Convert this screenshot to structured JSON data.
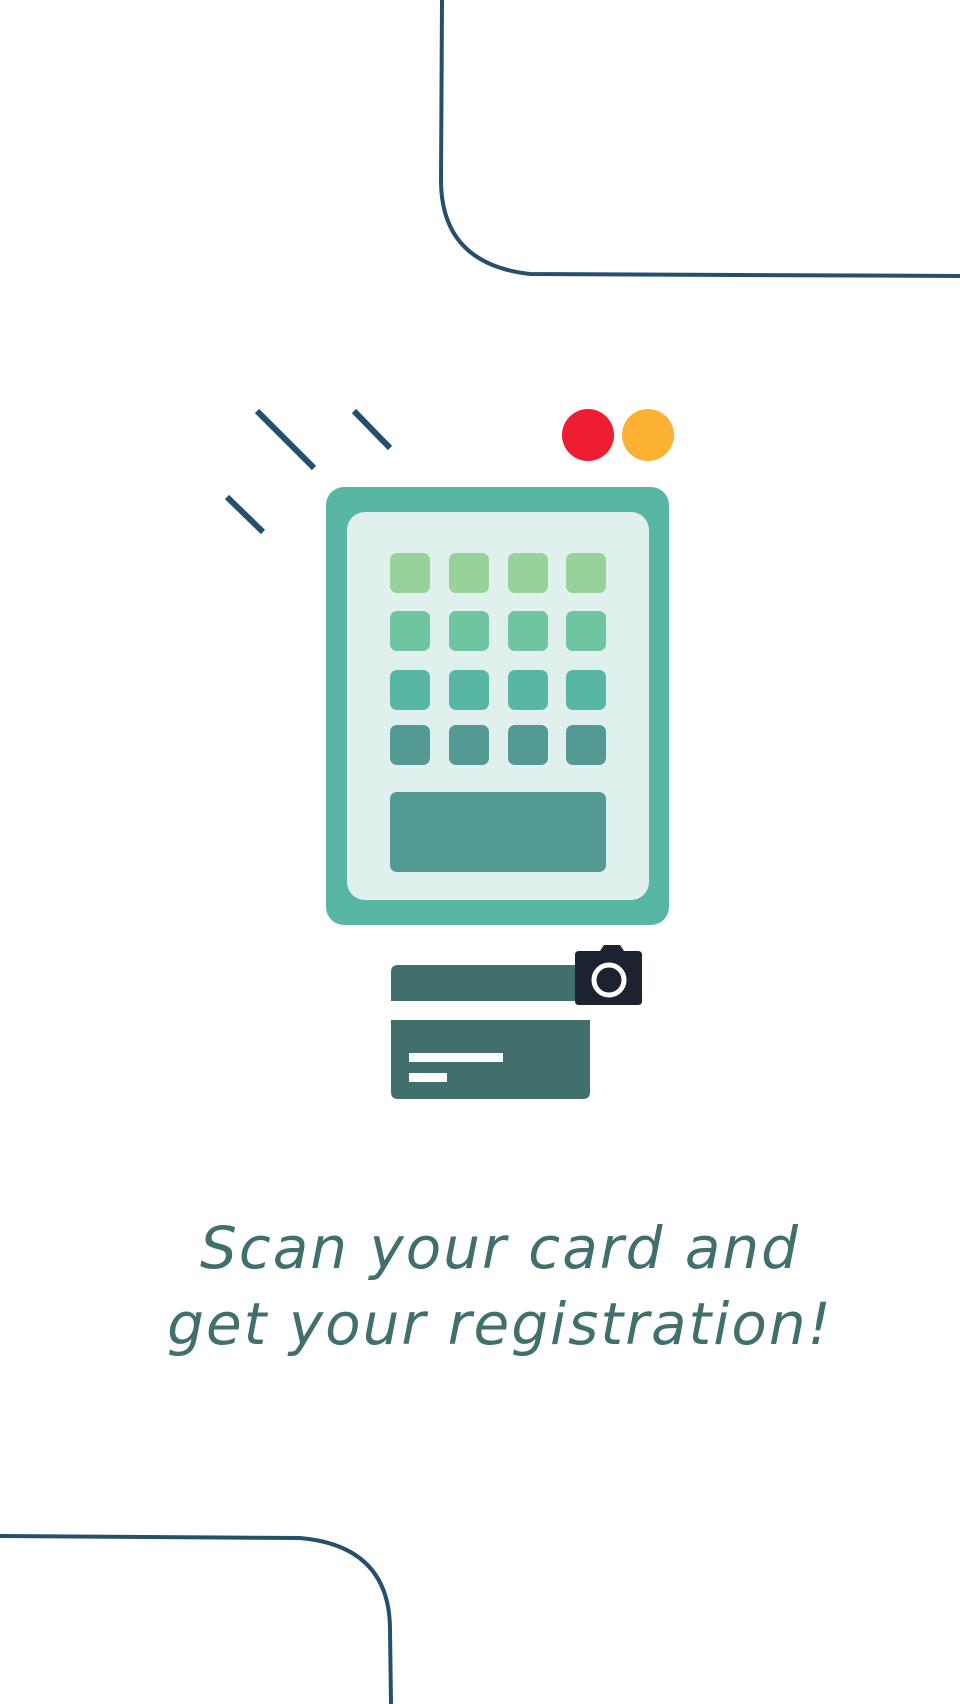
{
  "screen": {
    "name": "card-scan-onboarding"
  },
  "message": {
    "line1": "Scan your card and",
    "line2": "get your registration!"
  },
  "illustration": {
    "terminal_icon": "card-terminal-icon",
    "camera_icon": "camera-icon",
    "card_icon": "id-card-icon"
  },
  "colors": {
    "background": "#ffffff",
    "line_navy": "#264f6e",
    "terminal_frame": "#58b7a4",
    "terminal_screen": "#dff0ed",
    "key_row_1": "#98d199",
    "key_row_2": "#6fc59f",
    "key_row_3": "#58b7a4",
    "key_row_4": "#539994",
    "display_panel": "#539994",
    "card": "#416f6c",
    "camera": "#1c2230",
    "dot_red": "#ee1d31",
    "dot_yellow": "#fdb133",
    "text": "#416f6c"
  }
}
